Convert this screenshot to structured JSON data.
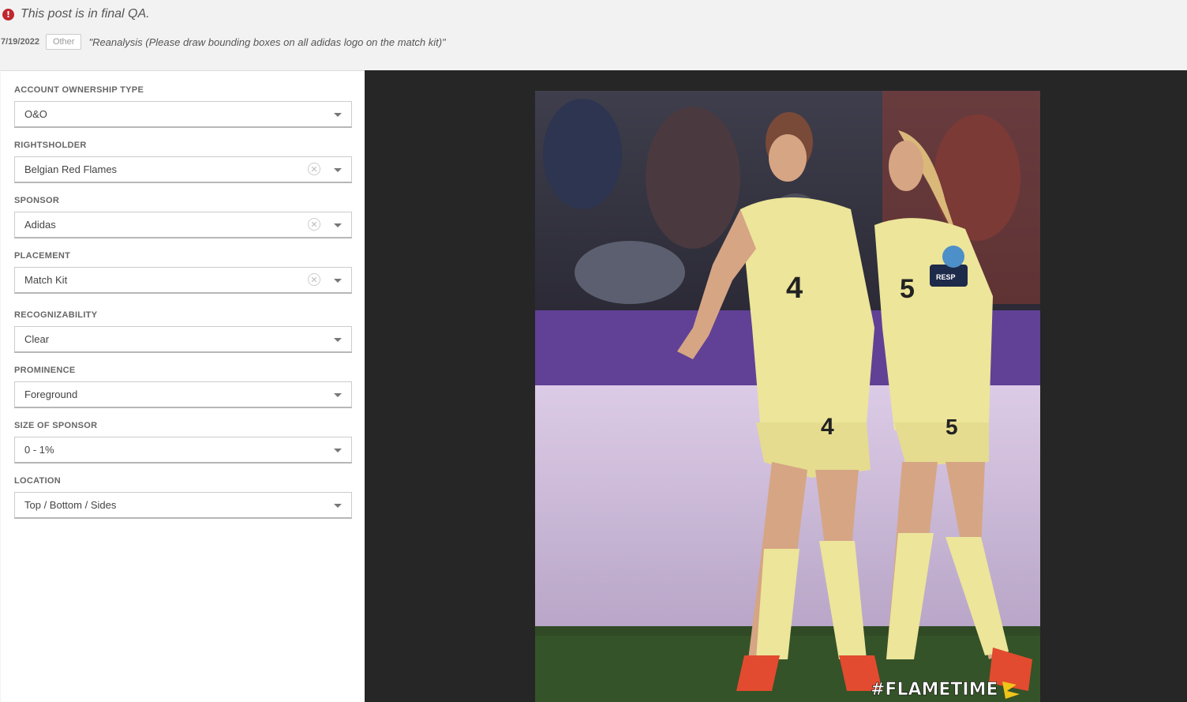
{
  "notice": {
    "icon": "alert-circle-icon",
    "text": "This post is in final QA."
  },
  "meta": {
    "date": "7/19/2022",
    "badge": "Other",
    "note": "\"Reanalysis (Please draw bounding boxes on all adidas logo on the match kit)\""
  },
  "form": {
    "fields": [
      {
        "label": "ACCOUNT OWNERSHIP TYPE",
        "value": "O&O",
        "clearable": false
      },
      {
        "label": "RIGHTSHOLDER",
        "value": "Belgian Red Flames",
        "clearable": true
      },
      {
        "label": "SPONSOR",
        "value": "Adidas",
        "clearable": true
      },
      {
        "label": "PLACEMENT",
        "value": "Match Kit",
        "clearable": true
      },
      {
        "label": "RECOGNIZABILITY",
        "value": "Clear",
        "clearable": false
      },
      {
        "label": "PROMINENCE",
        "value": "Foreground",
        "clearable": false
      },
      {
        "label": "SIZE OF SPONSOR",
        "value": "0 - 1%",
        "clearable": false
      },
      {
        "label": "LOCATION",
        "value": "Top / Bottom / Sides",
        "clearable": false
      }
    ]
  },
  "photo": {
    "players": [
      {
        "number": "4"
      },
      {
        "number": "5"
      }
    ],
    "shorts_numbers": [
      "4",
      "5"
    ],
    "armband_text": "RESP",
    "hashtag": "#FLAMETIME"
  },
  "colors": {
    "alert": "#c0262d",
    "viewer_bg": "#262626",
    "kit": "#ece59a"
  }
}
